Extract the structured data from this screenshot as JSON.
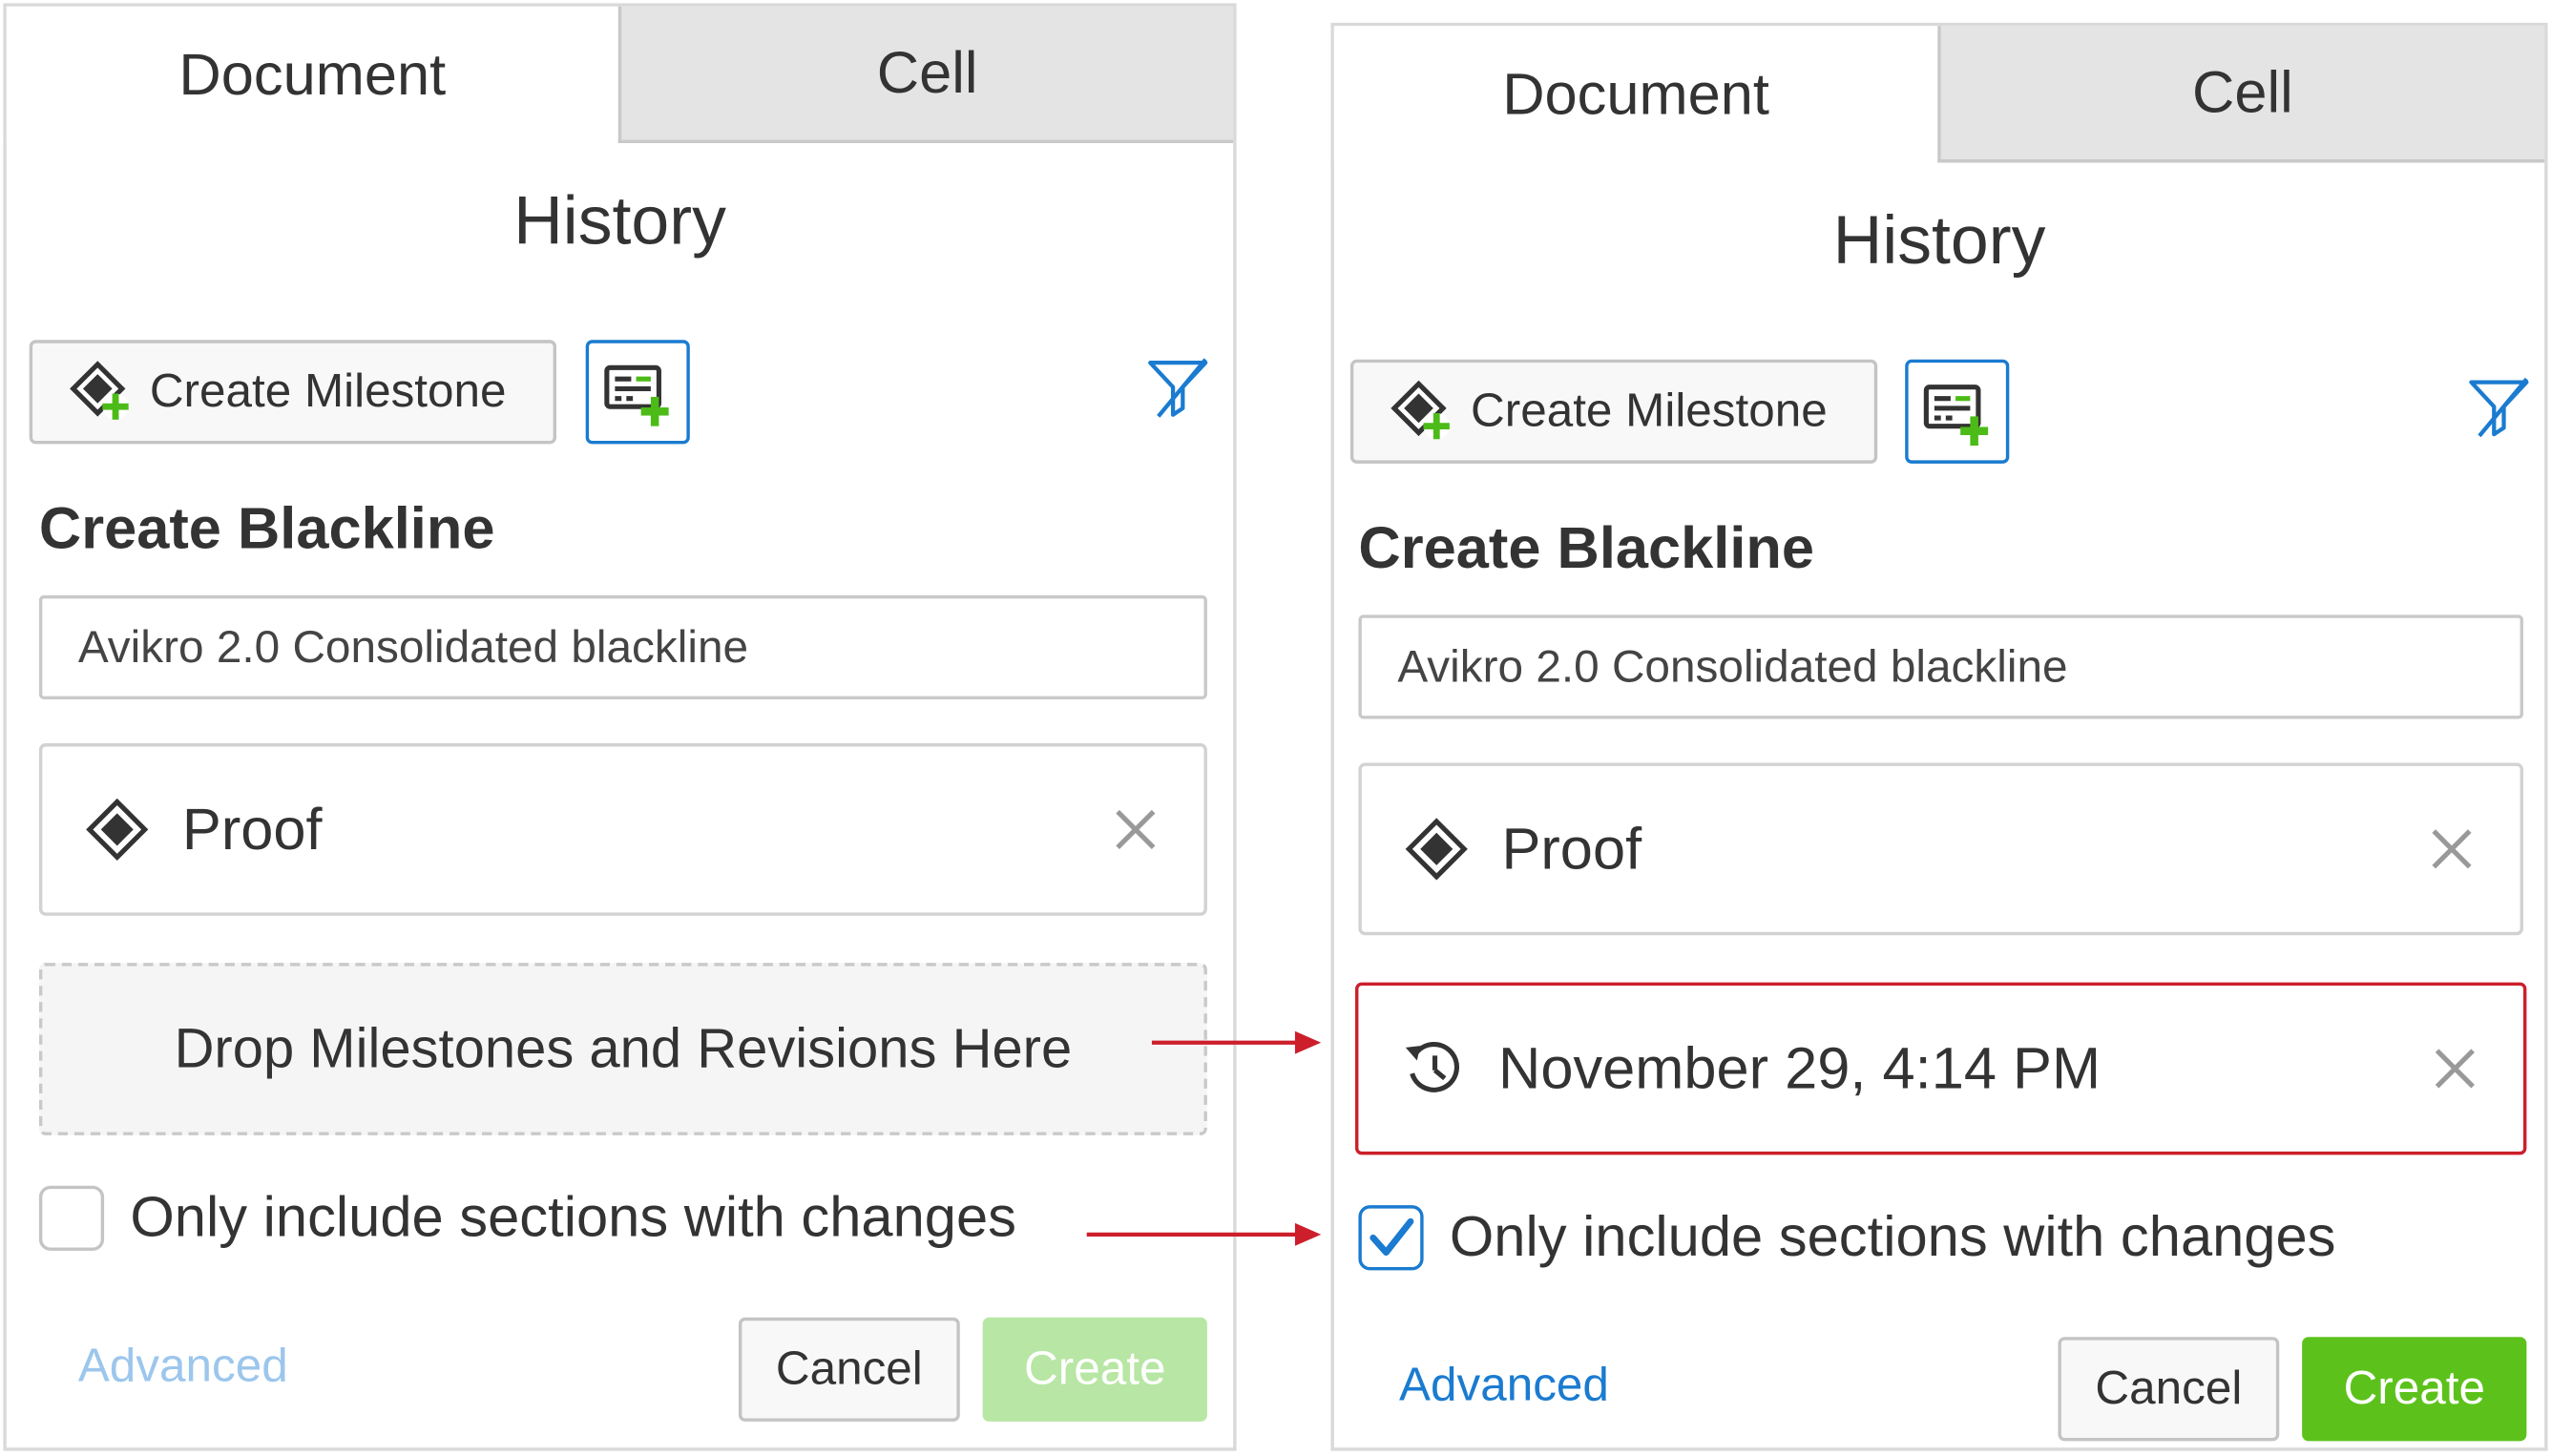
{
  "colors": {
    "accent_blue": "#1a7bd0",
    "create_green": "#5cc21b",
    "create_green_disabled": "#b8e6a4",
    "advanced_disabled": "#9cc6ec",
    "highlight_red": "#cc1f2b",
    "plus_green": "#4cbb17"
  },
  "before": {
    "tabs": [
      {
        "label": "Document"
      },
      {
        "label": "Cell"
      }
    ],
    "title": "History",
    "create_milestone_label": "Create Milestone",
    "create_milestone_icon": "milestone-add-icon",
    "create_blackline_icon": "blackline-add-icon",
    "filter_icon": "filter-icon",
    "section_title": "Create Blackline",
    "name_input_value": "Avikro 2.0 Consolidated blackline",
    "first_slot": {
      "icon": "milestone-icon",
      "label": "Proof"
    },
    "dropzone_text": "Drop Milestones and Revisions Here",
    "only_changes_label": "Only include sections with changes",
    "only_changes_checked": false,
    "advanced_label": "Advanced",
    "cancel_label": "Cancel",
    "create_label": "Create",
    "create_enabled": false
  },
  "after": {
    "tabs": [
      {
        "label": "Document"
      },
      {
        "label": "Cell"
      }
    ],
    "title": "History",
    "create_milestone_label": "Create Milestone",
    "create_milestone_icon": "milestone-add-icon",
    "create_blackline_icon": "blackline-add-icon",
    "filter_icon": "filter-icon",
    "section_title": "Create Blackline",
    "name_input_value": "Avikro 2.0 Consolidated blackline",
    "first_slot": {
      "icon": "milestone-icon",
      "label": "Proof"
    },
    "second_slot": {
      "icon": "revision-history-icon",
      "label": "November 29, 4:14 PM"
    },
    "only_changes_label": "Only include sections with changes",
    "only_changes_checked": true,
    "advanced_label": "Advanced",
    "cancel_label": "Cancel",
    "create_label": "Create",
    "create_enabled": true
  }
}
